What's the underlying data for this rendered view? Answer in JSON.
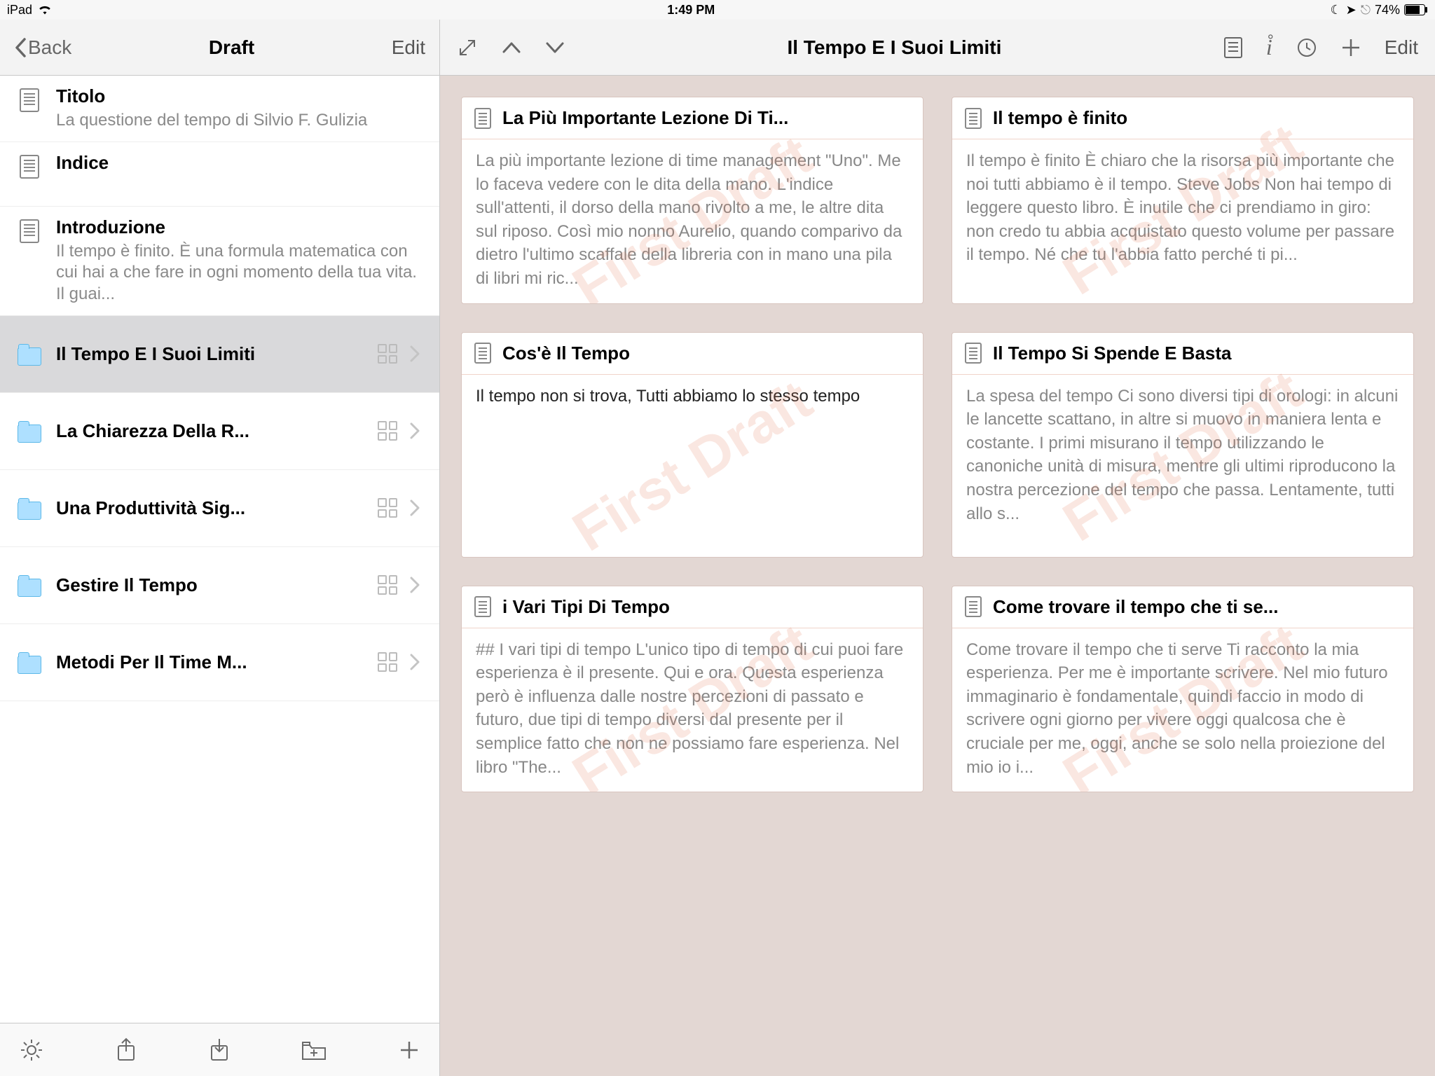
{
  "status": {
    "device": "iPad",
    "time": "1:49 PM",
    "battery": "74%"
  },
  "sidebar": {
    "back": "Back",
    "title": "Draft",
    "edit": "Edit",
    "items": [
      {
        "kind": "doc",
        "title": "Titolo",
        "sub": "La questione del tempo di Silvio F. Gulizia"
      },
      {
        "kind": "doc",
        "title": "Indice",
        "sub": ""
      },
      {
        "kind": "doc",
        "title": "Introduzione",
        "sub": "Il tempo è finito. È una formula matematica con cui hai a che fare in ogni momento della tua vita. Il guai..."
      },
      {
        "kind": "folder",
        "title": "Il Tempo E I Suoi Limiti",
        "selected": true
      },
      {
        "kind": "folder",
        "title": "La Chiarezza Della R..."
      },
      {
        "kind": "folder",
        "title": "Una Produttività Sig..."
      },
      {
        "kind": "folder",
        "title": "Gestire Il Tempo"
      },
      {
        "kind": "folder",
        "title": "Metodi Per Il Time M..."
      }
    ]
  },
  "main": {
    "title": "Il Tempo E I Suoi Limiti",
    "edit": "Edit",
    "watermark": "First Draft",
    "cards": [
      {
        "title": "La Più Importante Lezione Di Ti...",
        "body": "La più importante lezione di time management \"Uno\". Me lo faceva vedere con le dita della mano. L'indice sull'attenti, il dorso della mano rivolto a me, le altre dita sul riposo. Così mio nonno Aurelio, quando comparivo da dietro l'ultimo scaffale della libreria con in mano una pila di libri mi ric..."
      },
      {
        "title": "Il tempo è finito",
        "body": "Il tempo è finito È chiaro che la risorsa più importante che noi tutti abbiamo è il tempo. Steve Jobs Non hai tempo di leggere questo libro. È inutile che ci prendiamo in giro: non credo tu abbia acquistato questo volume per passare il tempo. Né che tu l'abbia fatto perché ti pi..."
      },
      {
        "title": "Cos'è Il Tempo",
        "body": "Il tempo non si trova, Tutti abbiamo lo stesso tempo",
        "dark": true
      },
      {
        "title": "Il Tempo Si Spende E Basta",
        "body": "La spesa del tempo Ci sono diversi tipi di orologi: in alcuni le lancette scattano, in altre si muovo in maniera lenta e costante. I primi misurano il tempo utilizzando le canoniche unità di misura, mentre gli ultimi riproducono la nostra percezione del tempo che passa. Lentamente, tutti allo s..."
      },
      {
        "title": "i Vari Tipi Di Tempo",
        "body": "## I vari tipi di tempo L'unico tipo di tempo di cui puoi fare esperienza è il presente. Qui e ora. Questa esperienza però è influenza dalle nostre percezioni di passato e futuro, due tipi di tempo diversi dal presente per il semplice fatto che non ne possiamo fare esperienza.  Nel libro \"The..."
      },
      {
        "title": "Come trovare il tempo che ti se...",
        "body": "Come trovare il tempo che ti serve Ti racconto la mia esperienza. Per me è importante scrivere. Nel mio futuro immaginario è fondamentale, quindi faccio in modo di scrivere ogni giorno per vivere oggi qualcosa che è cruciale per me, oggi, anche se solo nella proiezione del mio io i..."
      }
    ]
  }
}
